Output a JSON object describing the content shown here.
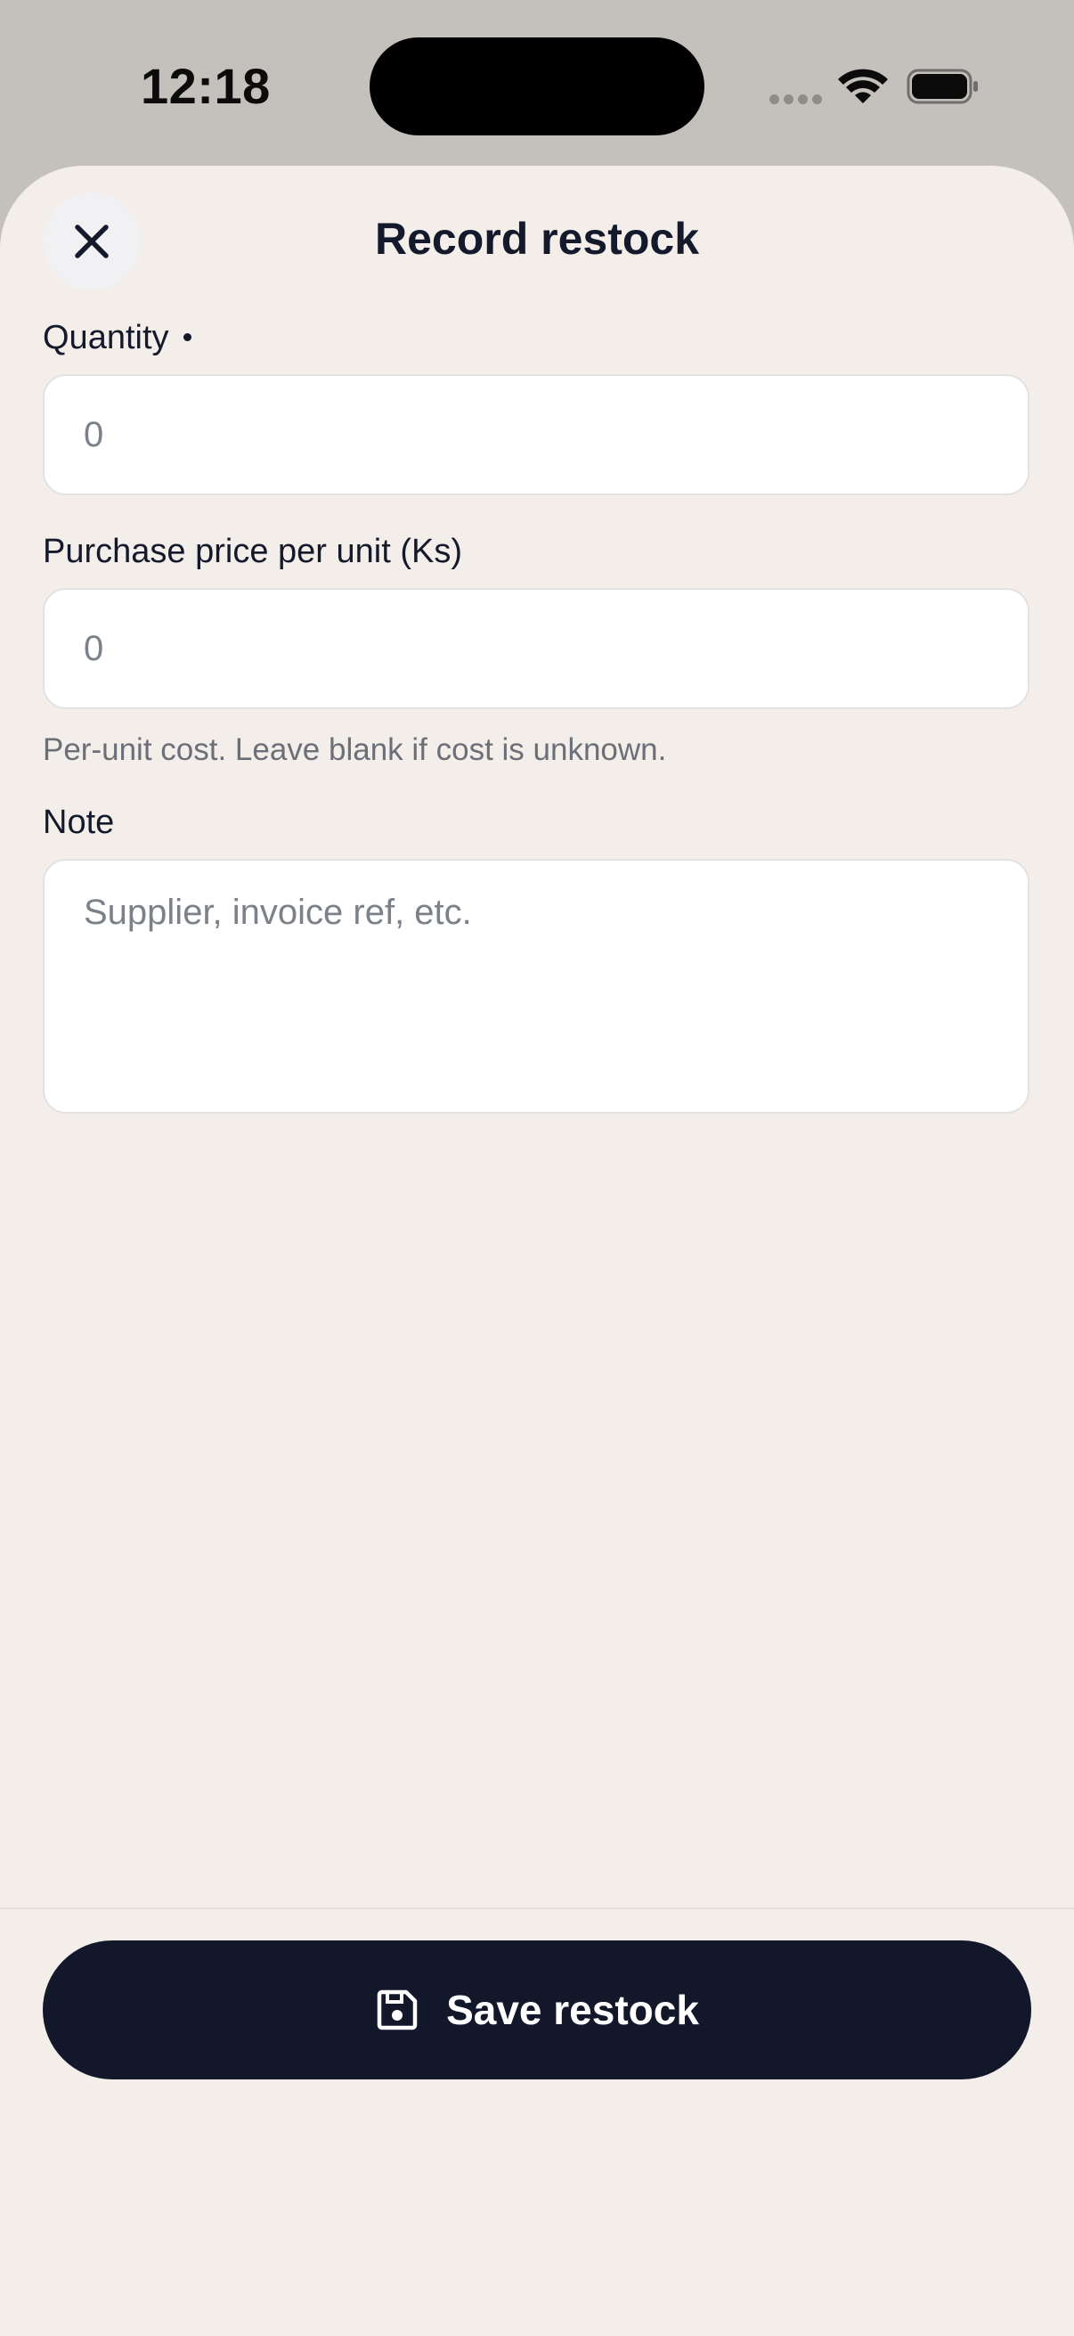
{
  "status_bar": {
    "time": "12:18"
  },
  "sheet": {
    "title": "Record restock",
    "close_icon": "close-icon"
  },
  "form": {
    "quantity": {
      "label": "Quantity",
      "required": true,
      "value": "",
      "placeholder": "0"
    },
    "purchase_price": {
      "label": "Purchase price per unit (Ks)",
      "value": "",
      "placeholder": "0",
      "helper": "Per-unit cost. Leave blank if cost is unknown."
    },
    "note": {
      "label": "Note",
      "value": "",
      "placeholder": "Supplier, invoice ref, etc."
    }
  },
  "footer": {
    "save_label": "Save restock",
    "save_icon": "save-icon"
  },
  "colors": {
    "sheet_background": "#f3eee9",
    "primary_button": "#12182a",
    "text_primary": "#141a2c",
    "text_muted": "#6b6f78"
  }
}
